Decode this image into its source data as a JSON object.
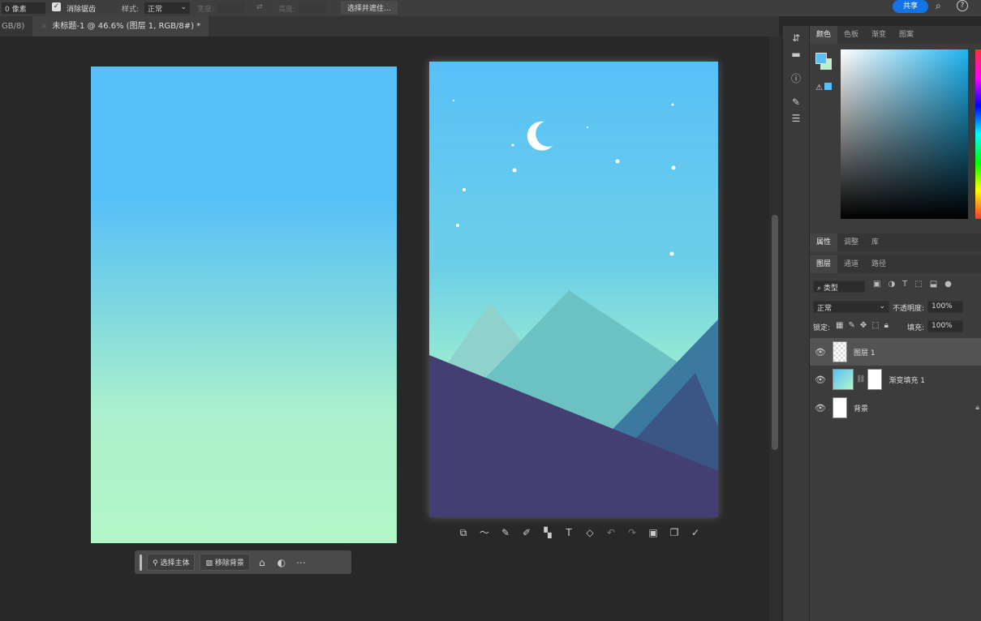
{
  "options_bar": {
    "feather_value": "0 像素",
    "antialias_label": "消除锯齿",
    "antialias_checked": true,
    "style_label": "样式:",
    "style_value": "正常",
    "width_label": "宽度:",
    "height_label": "高度:",
    "select_mask_button": "选择并遮住...",
    "share_button": "共享"
  },
  "tabs": [
    {
      "label": "GB/8)"
    },
    {
      "label": "未标题-1 @ 46.6% (图层 1, RGB/8#) *",
      "active": true
    }
  ],
  "canvas_left": {
    "gradient_top": "#58c0f8",
    "gradient_bottom": "#b3f6c8"
  },
  "canvas_right": {
    "sky_top": "#58c0f8",
    "sky_bottom": "#9eeed0",
    "ground": "#433f72"
  },
  "color_panel": {
    "tabs": [
      "颜色",
      "色板",
      "渐变",
      "图案"
    ],
    "active_tab": "颜色",
    "foreground": "#58c0f8",
    "background": "#b3f6c8"
  },
  "properties_panel": {
    "tabs": [
      "属性",
      "调整",
      "库"
    ]
  },
  "layers_panel": {
    "tabs": [
      "图层",
      "通道",
      "路径"
    ],
    "filter_label": "类型",
    "blend_mode": "正常",
    "opacity_label": "不透明度:",
    "opacity_value": "100%",
    "lock_label": "锁定:",
    "fill_label": "填充:",
    "fill_value": "100%",
    "layers": [
      {
        "name": "图层 1",
        "selected": true
      },
      {
        "name": "渐变填充 1"
      },
      {
        "name": "背景",
        "locked": true
      }
    ]
  },
  "context_taskbar": {
    "select_subject": "选择主体",
    "remove_background": "移除背景"
  }
}
